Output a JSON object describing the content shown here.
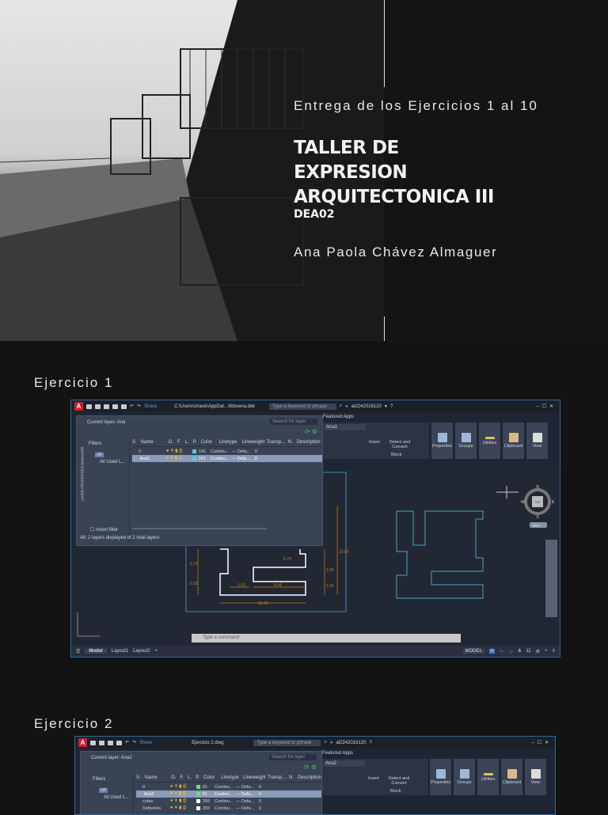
{
  "cover": {
    "subtitle": "Entrega de los Ejercicios 1 al 10",
    "title_lines": [
      "TALLER DE",
      "EXPRESION",
      "ARQUITECTONICA III"
    ],
    "course_code": "DEA02",
    "author": "Ana Paola Chávez Almaguer"
  },
  "exercises": [
    {
      "label": "Ejercicio 1",
      "app": {
        "file_path": "C:\\Users\\chave\\AppDat...\\Ibbsena.dwt",
        "share": "Share",
        "search_placeholder": "Type a keyword or phrase",
        "user": "al2242016120",
        "featured_apps": "Featured Apps",
        "layer_combo": "Ana1",
        "ribbon": [
          "Insert",
          "Detect and Convert",
          "Properties",
          "Groups",
          "Utilities",
          "Clipboard",
          "View"
        ],
        "block_label": "Block",
        "current_layer": "Current layer: Ana",
        "search_layer": "Search for layer",
        "filters": "Filters",
        "tree_all": "All",
        "tree_used": "All Used L...",
        "columns": [
          "S.",
          "Name",
          "O.",
          "F.",
          "L.",
          "P.",
          "Color",
          "Linetype",
          "Lineweight",
          "Transp...",
          "N.",
          "Description"
        ],
        "layers": [
          {
            "name": "0",
            "color": "141",
            "swatch": "#5ec8e8",
            "linetype": "Continu...",
            "lineweight": "Defa...",
            "transp": "0",
            "selected": false
          },
          {
            "name": "Ana1",
            "color": "141",
            "swatch": "#5ec8e8",
            "linetype": "Continu...",
            "lineweight": "Defa...",
            "transp": "0",
            "selected": true
          }
        ],
        "invert_filter": "Invert filter",
        "panel_side": "LAYER PROPERTIES MANAGER",
        "status_text": "All: 2 layers displayed of 2 total layers",
        "dimensions": [
          "10.00",
          "6.70",
          "1.10",
          "8.04",
          "15.00",
          "2.71",
          "2.02",
          "1.65",
          "1.55"
        ],
        "viewcube": {
          "top": "TOP",
          "n": "N",
          "s": "S",
          "e": "E",
          "w": "W",
          "wcs": "WCS"
        },
        "command_placeholder": "Type a command",
        "tabs": [
          "Model",
          "Layout1",
          "Layout2"
        ],
        "model_badge": "MODEL",
        "scale": "11"
      }
    },
    {
      "label": "Ejercicio 2",
      "app": {
        "file_path": "Ejercicio 2.dwg",
        "share": "Share",
        "search_placeholder": "Type a keyword or phrase",
        "user": "al2242016120",
        "featured_apps": "Featured Apps",
        "layer_combo": "Ana2",
        "ribbon": [
          "Insert",
          "Detect and Convert",
          "Properties",
          "Groups",
          "Utilities",
          "Clipboard",
          "View"
        ],
        "block_label": "Block",
        "current_layer": "Current layer: Ana2",
        "search_layer": "Search for layer",
        "filters": "Filters",
        "tree_all": "All",
        "tree_used": "All Used L...",
        "columns": [
          "S.",
          "Name",
          "O.",
          "F.",
          "L.",
          "P.",
          "Color",
          "Linetype",
          "Lineweight",
          "Transp...",
          "N.",
          "Description"
        ],
        "layers": [
          {
            "name": "0",
            "color": "81",
            "swatch": "#6fe06f",
            "linetype": "Continu...",
            "lineweight": "Defa...",
            "transp": "0",
            "selected": false
          },
          {
            "name": "Ana2",
            "color": "81",
            "swatch": "#6fe06f",
            "linetype": "Continu...",
            "lineweight": "Defa...",
            "transp": "0",
            "selected": true
          },
          {
            "name": "cotas",
            "color": "255",
            "swatch": "#ffffff",
            "linetype": "Continu...",
            "lineweight": "Defa...",
            "transp": "0",
            "selected": false
          },
          {
            "name": "Defpoints",
            "color": "255",
            "swatch": "#ffffff",
            "linetype": "Continu...",
            "lineweight": "Defa...",
            "transp": "0",
            "selected": false
          }
        ]
      }
    }
  ]
}
